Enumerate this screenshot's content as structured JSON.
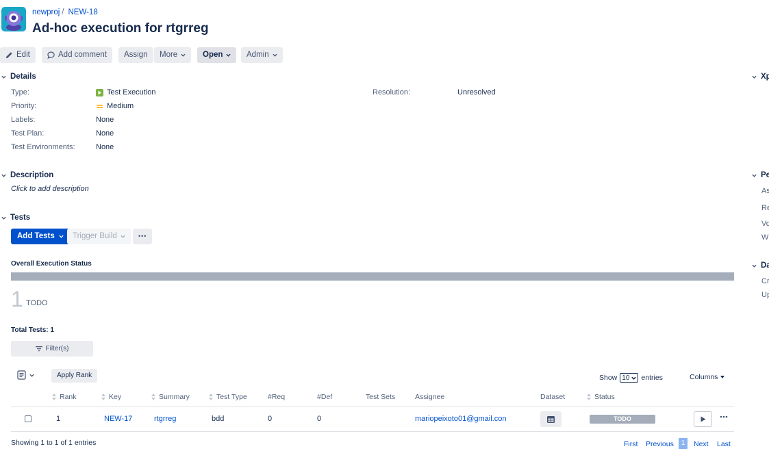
{
  "header": {
    "project": "newproj",
    "issue_key": "NEW-18",
    "title": "Ad-hoc execution for rtgrreg"
  },
  "toolbar": {
    "edit": "Edit",
    "add_comment": "Add comment",
    "assign": "Assign",
    "more": "More",
    "status": "Open",
    "admin": "Admin"
  },
  "details": {
    "heading": "Details",
    "fields": [
      {
        "label": "Type:",
        "value": "Test Execution"
      },
      {
        "label": "Priority:",
        "value": "Medium"
      },
      {
        "label": "Labels:",
        "value": "None"
      },
      {
        "label": "Test Plan:",
        "value": "None"
      },
      {
        "label": "Test Environments:",
        "value": "None"
      }
    ],
    "resolution_label": "Resolution:",
    "resolution_value": "Unresolved"
  },
  "description": {
    "heading": "Description",
    "placeholder": "Click to add description"
  },
  "tests": {
    "heading": "Tests",
    "add_tests": "Add Tests",
    "trigger_build": "Trigger Build",
    "more": "•••",
    "overall_status_label": "Overall Execution Status",
    "overall_count": "1",
    "overall_status": "TODO",
    "total_tests": "Total Tests: 1",
    "filter": "Filter(s)",
    "apply_rank": "Apply Rank",
    "show_label": "Show",
    "show_value": "10",
    "entries_label": "entries",
    "columns": "Columns",
    "headers": [
      "Rank",
      "Key",
      "Summary",
      "Test Type",
      "#Req",
      "#Def",
      "Test Sets",
      "Assignee",
      "Dataset",
      "Status"
    ],
    "rows": [
      {
        "rank": "1",
        "key": "NEW-17",
        "summary": "rtgrreg",
        "test_type": "bdd",
        "req": "0",
        "def": "0",
        "test_sets": "",
        "assignee": "mariopeixoto01@gmail.con",
        "status": "TODO"
      }
    ],
    "showing": "Showing 1 to 1 of 1 entries",
    "pagination": {
      "first": "First",
      "previous": "Previous",
      "current": "1",
      "next": "Next",
      "last": "Last"
    }
  },
  "right_panel": {
    "sections": [
      "Xp",
      "Pe",
      "Da"
    ],
    "people_items": [
      "As",
      "Re",
      "Vo",
      "W"
    ],
    "dates_items": [
      "Cr",
      "Up"
    ]
  },
  "colors": {
    "primary": "#0052cc",
    "todo": "#a5adba",
    "avatar": "#1aa6c7",
    "type_icon": "#7cb342",
    "priority_icon": "#ffab00"
  }
}
